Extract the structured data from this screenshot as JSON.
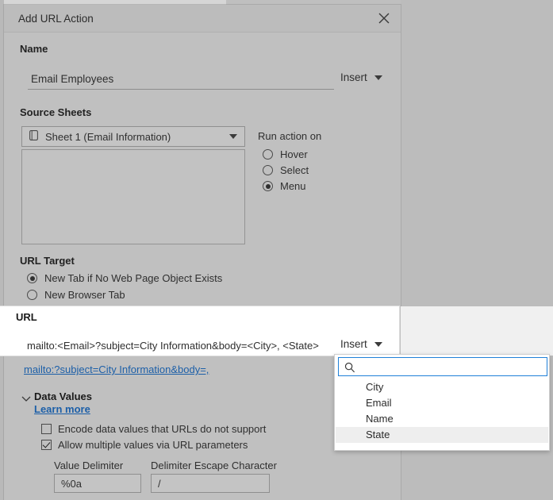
{
  "dialog": {
    "title": "Add URL Action",
    "close_icon": "close-icon"
  },
  "name_section": {
    "label": "Name",
    "value": "Email Employees",
    "placeholder": "",
    "insert_label": "Insert"
  },
  "source_sheets": {
    "label": "Source Sheets",
    "selected_sheet": "Sheet 1 (Email Information)",
    "sheet_icon": "worksheet-icon"
  },
  "run_action_on": {
    "label": "Run action on",
    "options": [
      {
        "label": "Hover",
        "checked": false
      },
      {
        "label": "Select",
        "checked": false
      },
      {
        "label": "Menu",
        "checked": true
      }
    ]
  },
  "url_target": {
    "label": "URL Target",
    "options": [
      {
        "label": "New Tab if No Web Page Object Exists",
        "checked": true
      },
      {
        "label": "New Browser Tab",
        "checked": false
      }
    ]
  },
  "url_section": {
    "label": "URL",
    "value": "mailto:<Email>?subject=City Information&body=<City>, <State>",
    "placeholder": "",
    "insert_label": "Insert",
    "preview_link": "mailto:?subject=City Information&body=,"
  },
  "data_values": {
    "title": "Data Values",
    "chevron_icon": "chevron-down-icon",
    "learn_more": "Learn more",
    "checkboxes": [
      {
        "label": "Encode data values that URLs do not support",
        "checked": false
      },
      {
        "label": "Allow multiple values via URL parameters",
        "checked": true
      }
    ],
    "value_delimiter": {
      "label": "Value Delimiter",
      "value": "%0a"
    },
    "delimiter_escape": {
      "label": "Delimiter Escape Character",
      "value": "/"
    }
  },
  "insert_dropdown": {
    "search_icon": "search-icon",
    "search_value": "",
    "search_placeholder": "",
    "items": [
      {
        "label": "City",
        "highlighted": false
      },
      {
        "label": "Email",
        "highlighted": false
      },
      {
        "label": "Name",
        "highlighted": false
      },
      {
        "label": "State",
        "highlighted": true
      }
    ]
  },
  "colors": {
    "dialog_bg": "#c0c0c0",
    "titlebar_bg": "#bcbcbc",
    "highlight_band": "#ffffff",
    "link": "#1c5fa8",
    "focus_border": "#1f80d8",
    "row_highlight": "#eeeeee"
  }
}
